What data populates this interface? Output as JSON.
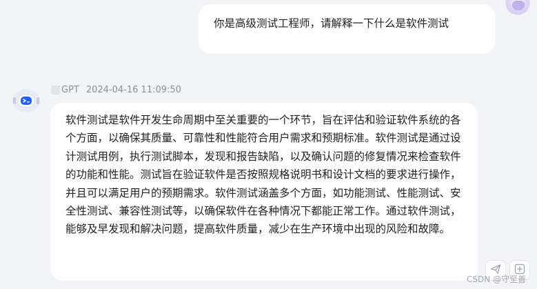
{
  "conversation": {
    "user_message": {
      "text": "你是高级测试工程师，请解释一下什么是软件测试"
    },
    "bot_message": {
      "model": "GPT",
      "timestamp": "2024-04-16 11:09:50",
      "text": "软件测试是软件开发生命周期中至关重要的一个环节，旨在评估和验证软件系统的各个方面，以确保其质量、可靠性和性能符合用户需求和预期标准。软件测试是通过设计测试用例，执行测试脚本，发现和报告缺陷，以及确认问题的修复情况来检查软件的功能和性能。测试旨在验证软件是否按照规格说明书和设计文档的要求进行操作，并且可以满足用户的预期需求。软件测试涵盖多个方面，如功能测试、性能测试、安全性测试、兼容性测试等，以确保软件在各种情况下都能正常工作。通过软件测试，能够及早发现和解决问题，提高软件质量，减少在生产环境中出现的风险和故障。"
    }
  },
  "icons": {
    "user_avatar": "user-avatar-icon",
    "bot_avatar": "robot-icon",
    "model": "model-icon",
    "send": "paper-plane-icon",
    "add": "plus-square-icon"
  },
  "watermark": "CSDN @守至善",
  "colors": {
    "page_background": "#f3f4f8",
    "bubble_background": "#ffffff",
    "meta_text": "#8a8f99",
    "bot_accent": "#1f5fff"
  }
}
